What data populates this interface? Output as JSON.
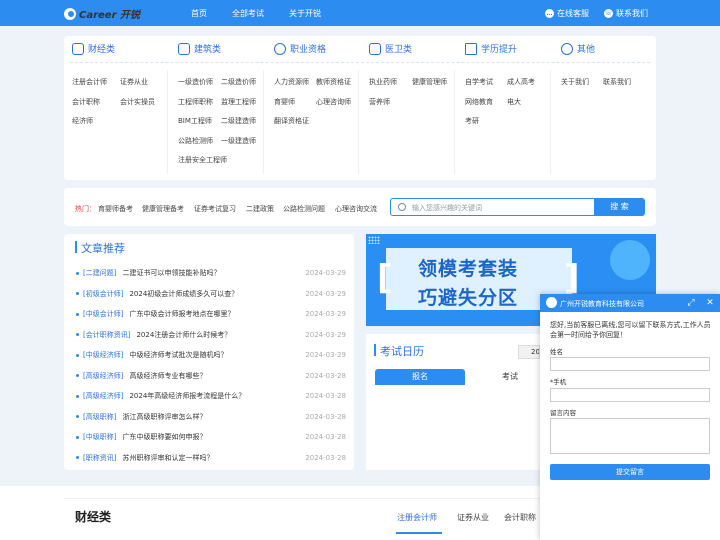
{
  "header": {
    "logo_text": "Career 开锐",
    "nav": [
      "首页",
      "全部考试",
      "关于开锐"
    ],
    "online_service": "在线客服",
    "contact_us": "联系我们"
  },
  "categories": [
    {
      "title": "财经类",
      "icon": "coins-icon",
      "links": [
        "注册会计师",
        "证券从业",
        "会计职称",
        "会计实操员",
        "经济师"
      ]
    },
    {
      "title": "建筑类",
      "icon": "building-icon",
      "links": [
        "一级造价师",
        "二级造价师",
        "工程师职称",
        "监理工程师",
        "BIM工程师",
        "二级建造师",
        "公路检测师",
        "一级建造师",
        "注册安全工程师"
      ]
    },
    {
      "title": "职业资格",
      "icon": "person-icon",
      "links": [
        "人力资源师",
        "教师资格证",
        "育婴师",
        "心理咨询师",
        "翻译资格证"
      ]
    },
    {
      "title": "医卫类",
      "icon": "medical-icon",
      "links": [
        "执业药师",
        "健康管理师",
        "营养师"
      ]
    },
    {
      "title": "学历提升",
      "icon": "graduation-cap-icon",
      "links": [
        "自学考试",
        "成人高考",
        "网络教育",
        "电大",
        "考研"
      ]
    },
    {
      "title": "其他",
      "icon": "more-icon",
      "links": [
        "关于我们",
        "联系我们"
      ]
    }
  ],
  "hot": {
    "label": "热门：",
    "items": [
      "育婴师备考",
      "健康管理备考",
      "证券考试复习",
      "二建政策",
      "公路检测问题",
      "心理咨询交流"
    ]
  },
  "search": {
    "placeholder": "输入您感兴趣的关键词",
    "button": "搜 索"
  },
  "articles": {
    "title": "文章推荐",
    "items": [
      {
        "tag": "[二建问题]",
        "title": "二建证书可以申领技能补贴吗？",
        "date": "2024-03-29"
      },
      {
        "tag": "[初级会计师]",
        "title": "2024初级会计师成绩多久可以查？",
        "date": "2024-03-29"
      },
      {
        "tag": "[中级会计师]",
        "title": "广东中级会计师报考地点在哪里？",
        "date": "2024-03-29"
      },
      {
        "tag": "[会计职称资讯]",
        "title": "2024注册会计师什么时候考？",
        "date": "2024-03-29"
      },
      {
        "tag": "[中级经济师]",
        "title": "中级经济师考试批次是随机吗？",
        "date": "2024-03-29"
      },
      {
        "tag": "[高级经济师]",
        "title": "高级经济师专业有哪些？",
        "date": "2024-03-28"
      },
      {
        "tag": "[高级经济师]",
        "title": "2024年高级经济师报考流程是什么？",
        "date": "2024-03-28"
      },
      {
        "tag": "[高级职称]",
        "title": "浙江高级职称评审怎么样？",
        "date": "2024-03-28"
      },
      {
        "tag": "[中级职称]",
        "title": "广东中级职称要如何申报？",
        "date": "2024-03-28"
      },
      {
        "tag": "[职称资讯]",
        "title": "苏州职称评审和认定一样吗？",
        "date": "2024-03-28"
      }
    ]
  },
  "banner": {
    "line1": "领模考套装",
    "line2": "巧避失分区"
  },
  "calendar": {
    "title": "考试日历",
    "year": "2024",
    "tabs": [
      "报名",
      "考试"
    ]
  },
  "bottom": {
    "title": "财经类",
    "tabs": [
      "注册会计师",
      "证券从业",
      "会计职称"
    ]
  },
  "chat": {
    "company": "广州开锐教育科技有限公司",
    "message": "您好,当前客服已离线,您可以留下联系方式,工作人员会第一时间给予你回复！",
    "name_label": "姓名",
    "phone_label": "*手机",
    "message_label": "留言内容",
    "submit": "提交留言"
  },
  "colors": {
    "primary": "#2d8cf0",
    "hot": "#e03c3c",
    "link_blue": "#2d72d9"
  }
}
